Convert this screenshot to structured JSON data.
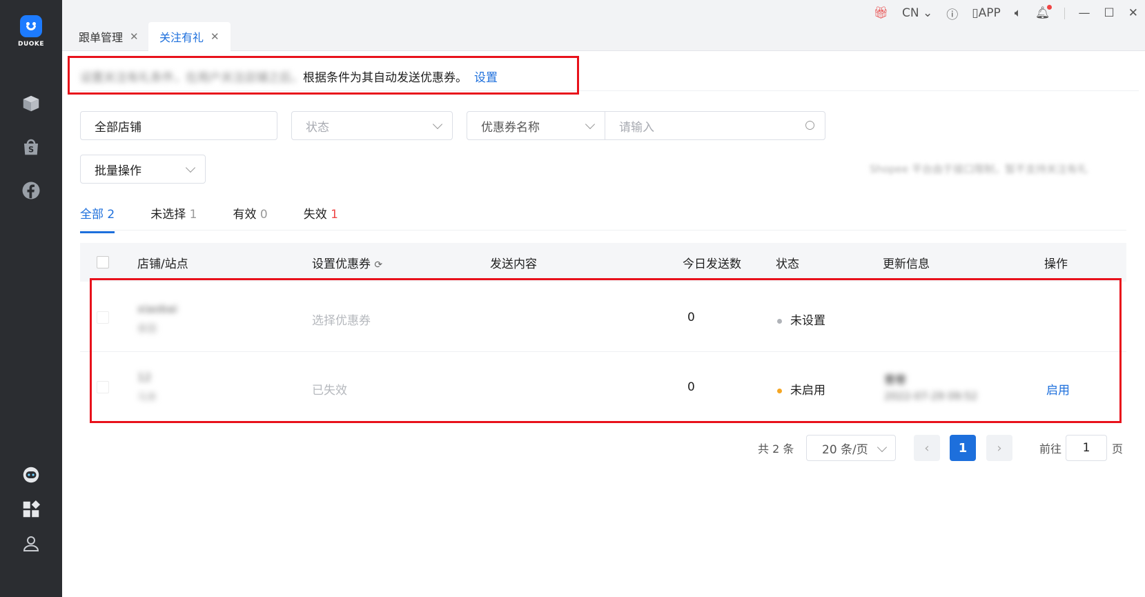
{
  "sidebar": {
    "logo_text": "DUOKE"
  },
  "tabs": [
    {
      "label": "跟单管理"
    },
    {
      "label": "关注有礼"
    }
  ],
  "topbar": {
    "lang": "CN",
    "app_label": "APP"
  },
  "notice": {
    "blurred_text": "设置关注有礼条件，在用户关注店铺之后，",
    "text": "根据条件为其自动发送优惠券。",
    "link": "设置"
  },
  "filters": {
    "shop": "全部店铺",
    "status_placeholder": "状态",
    "coupon_field": "优惠券名称",
    "search_placeholder": "请输入",
    "batch": "批量操作",
    "hint": "Shopee 平台由于接口限制，暂不支持关注有礼"
  },
  "status_tabs": [
    {
      "label": "全部",
      "count": "2"
    },
    {
      "label": "未选择",
      "count": "1"
    },
    {
      "label": "有效",
      "count": "0"
    },
    {
      "label": "失效",
      "count": "1"
    }
  ],
  "table": {
    "headers": {
      "shop": "店铺/站点",
      "coupon": "设置优惠券",
      "content": "发送内容",
      "today": "今日发送数",
      "status": "状态",
      "update": "更新信息",
      "action": "操作"
    },
    "rows": [
      {
        "shop": "xiaobai",
        "site": "泰国",
        "coupon": "选择优惠券",
        "today": "0",
        "status": "未设置",
        "status_color": "#b0b3b8",
        "updater": "",
        "update_time": "",
        "action": ""
      },
      {
        "shop": "12",
        "site": "马来",
        "coupon": "已失效",
        "today": "0",
        "status": "未启用",
        "status_color": "#f5a623",
        "updater": "青枣",
        "update_time": "2022-07-29 09:52",
        "action": "启用"
      }
    ]
  },
  "pagination": {
    "total": "共 2 条",
    "page_size": "20 条/页",
    "current": "1",
    "goto_label": "前往",
    "goto_value": "1",
    "page_unit": "页"
  },
  "colors": {
    "accent": "#1d6fdc",
    "highlight": "#e8111b",
    "sidebar": "#2b2d31"
  }
}
